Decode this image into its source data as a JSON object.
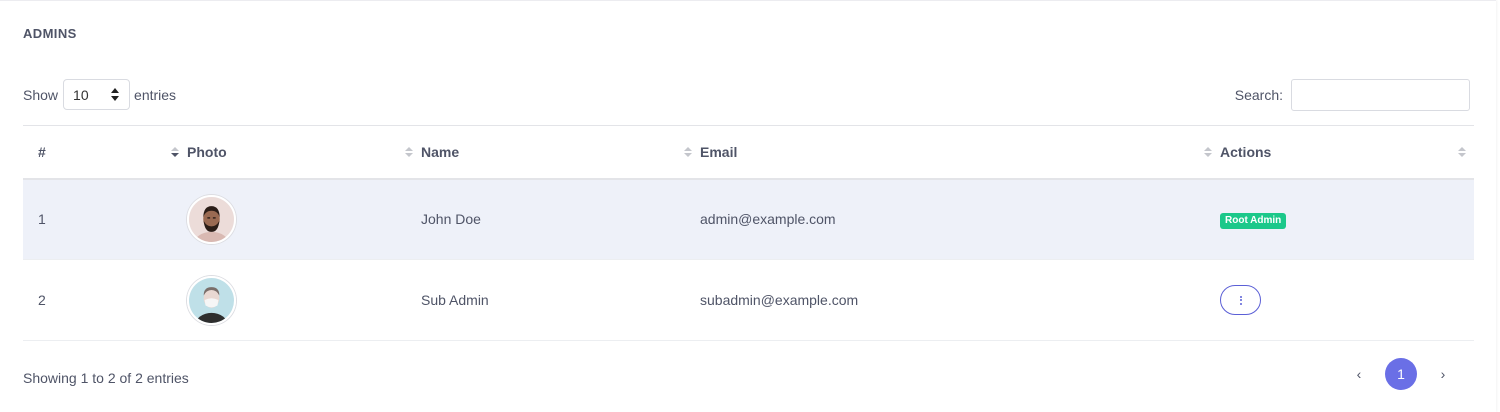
{
  "card": {
    "title": "ADMINS"
  },
  "length": {
    "show_label": "Show",
    "value": "10",
    "entries_label": "entries"
  },
  "search": {
    "label": "Search:",
    "value": "",
    "placeholder": ""
  },
  "table": {
    "headers": [
      "#",
      "Photo",
      "Name",
      "Email",
      "Actions"
    ],
    "sorted_column": "#",
    "rows": [
      {
        "num": "1",
        "photo_icon": "avatar-photo",
        "name": "John Doe",
        "email": "admin@example.com",
        "action_badge": "Root Admin"
      },
      {
        "num": "2",
        "photo_icon": "avatar-photo",
        "name": "Sub Admin",
        "email": "subadmin@example.com",
        "action_icon": "more-vertical-icon"
      }
    ]
  },
  "footer": {
    "info": "Showing 1 to 2 of 2 entries",
    "prev": "‹",
    "current_page": "1",
    "next": "›"
  },
  "colors": {
    "accent": "#6a6fe6",
    "badge": "#1bc88a",
    "row_highlight": "#eef1f9",
    "text": "#4f5467"
  }
}
